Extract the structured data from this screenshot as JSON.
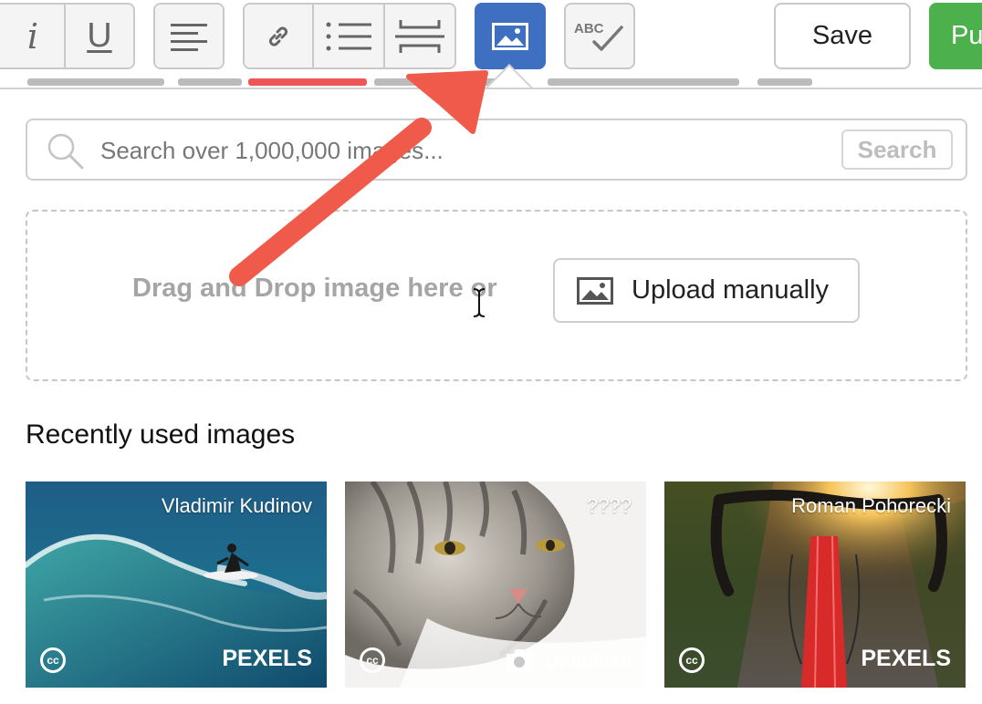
{
  "toolbar": {
    "italic_label": "i",
    "underline_label": "U",
    "save_label": "Save",
    "publish_label": "Pu"
  },
  "image_picker": {
    "search": {
      "placeholder": "Search over 1,000,000 images...",
      "button_label": "Search"
    },
    "drop_zone_text": "Drag and Drop image here or",
    "upload_button_label": "Upload manually",
    "recent_title": "Recently used images",
    "recent_images": [
      {
        "author": "Vladimir Kudinov",
        "source": "PEXELS",
        "license_icon": "cc-icon",
        "subject": "surfer-on-wave"
      },
      {
        "author": "????",
        "source": "Unsplash",
        "license_icon": "cc-icon",
        "subject": "tabby-cat"
      },
      {
        "author": "Roman Pohorecki",
        "source": "PEXELS",
        "license_icon": "cc-icon",
        "subject": "bicycle-handlebars-sunset"
      }
    ]
  },
  "colors": {
    "active_image_button": "#3f6fc1",
    "publish_button": "#4cb04c",
    "annotation_arrow": "#f05a4a"
  },
  "icons": [
    "italic-icon",
    "underline-icon",
    "align-left-icon",
    "link-icon",
    "list-icon",
    "horizontal-rule-icon",
    "image-icon",
    "spellcheck-icon",
    "search-icon",
    "upload-image-icon",
    "cc-icon",
    "camera-icon",
    "text-cursor-icon"
  ]
}
